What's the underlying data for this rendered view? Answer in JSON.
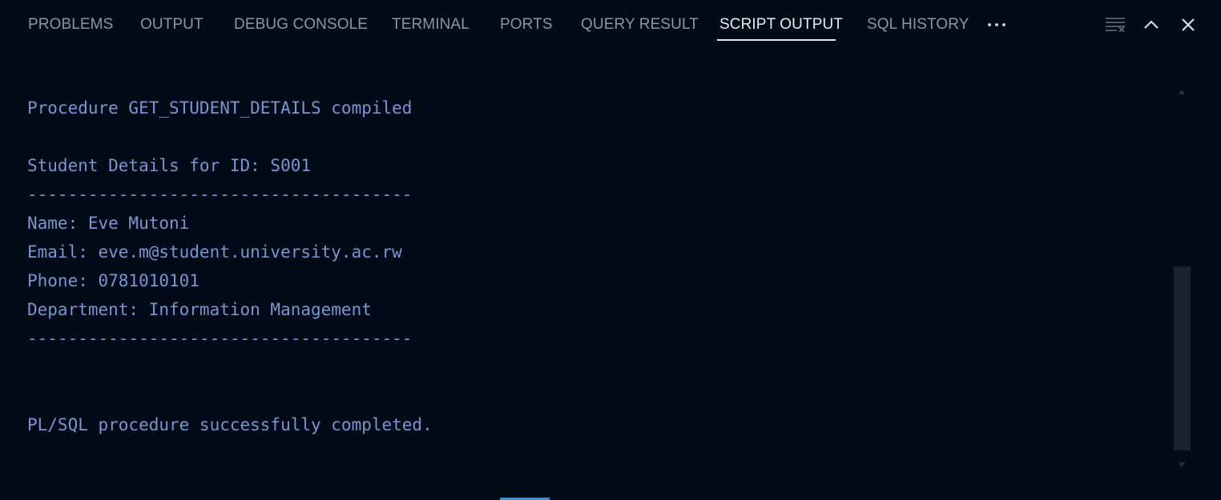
{
  "tabs": [
    {
      "label": "PROBLEMS"
    },
    {
      "label": "OUTPUT"
    },
    {
      "label": "DEBUG CONSOLE"
    },
    {
      "label": "TERMINAL"
    },
    {
      "label": "PORTS"
    },
    {
      "label": "QUERY RESULT"
    },
    {
      "label": "SCRIPT OUTPUT",
      "active": true
    },
    {
      "label": "SQL HISTORY"
    }
  ],
  "actions": {
    "more": "more-actions-icon",
    "clear": "clear-output-icon",
    "maximize": "chevron-up-icon",
    "close": "close-icon"
  },
  "output": {
    "lines": [
      "Procedure GET_STUDENT_DETAILS compiled",
      "",
      "Student Details for ID: S001",
      "--------------------------------------",
      "Name: Eve Mutoni",
      "Email: eve.m@student.university.ac.rw",
      "Phone: 0781010101",
      "Department: Information Management",
      "--------------------------------------",
      "",
      "",
      "PL/SQL procedure successfully completed."
    ]
  },
  "colors": {
    "background": "#010b18",
    "tab_inactive": "#8b95a3",
    "tab_active": "#e8ecf0",
    "output_text": "#7a95d0"
  }
}
